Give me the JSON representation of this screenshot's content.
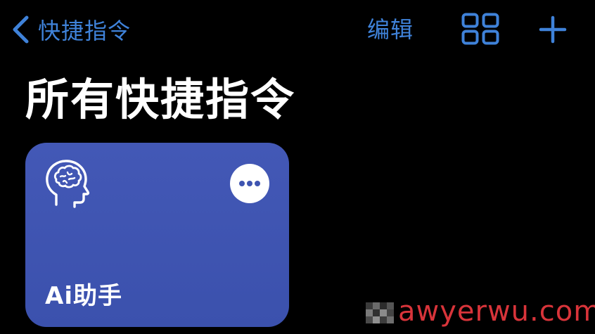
{
  "nav": {
    "back_label": "快捷指令",
    "edit_label": "编辑",
    "back_icon": "chevron-left-icon",
    "grid_icon": "grid-view-icon",
    "add_icon": "plus-icon"
  },
  "page": {
    "title": "所有快捷指令"
  },
  "shortcuts": [
    {
      "name": "Ai助手",
      "icon": "brain-head-icon",
      "more_icon": "ellipsis-icon",
      "color": "#4056b3"
    }
  ],
  "watermark": {
    "text": "awyerwu.com"
  },
  "colors": {
    "accent": "#3f82d9",
    "background": "#000000",
    "tile": "#4056b3",
    "watermark": "#d8343a"
  }
}
